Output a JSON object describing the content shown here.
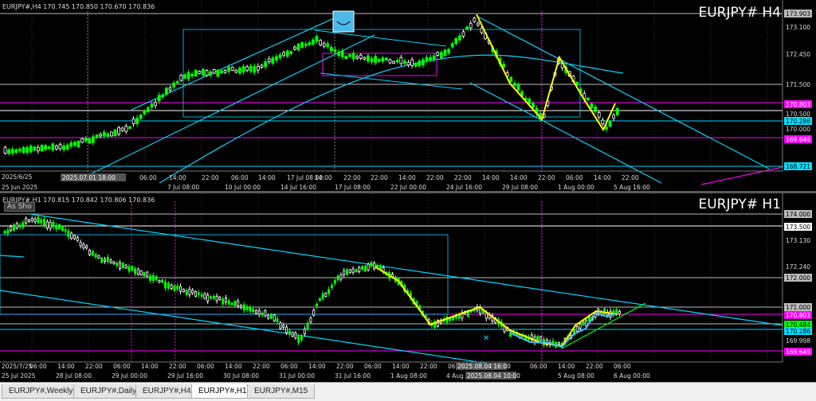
{
  "top_chart": {
    "header": "EURJPY#,H4  170.745 170.850 170.670 170.836",
    "symbol": "EURJPY#  H4",
    "price_labels": [
      "173.903",
      "173.100",
      "172.450",
      "171.500",
      "170.803",
      "170.500",
      "170.286",
      "170.000",
      "169.646",
      "168.721"
    ],
    "time_labels": [
      "2025/6/25",
      "25 Jun 2025",
      "2025.07.01 18:00",
      "06:00",
      "7 Jul 08:00",
      "14:00",
      "22:00",
      "10 Jul 00:00",
      "06:00",
      "14 Jul 16:00",
      "14:00",
      "17 Jul 08:00",
      "22:00",
      "22 Jul 00:00",
      "14:00",
      "24 Jul 16:00",
      "06:00",
      "29 Jul 08:00",
      "22:00",
      "1 Aug 00:00",
      "14:00",
      "5 Aug 16:00",
      "22:00",
      "06:00",
      "14:00",
      "22:00",
      "06:00",
      "14:00",
      "22:00",
      "06:00",
      "14:00",
      "22:00",
      "06:00"
    ],
    "time_date_label": "2025.07.01 18:00"
  },
  "bottom_chart": {
    "header": "EURJPY#,H1  170.815 170.842 170.806 170.836",
    "symbol": "EURJPY#  H1",
    "as_shot": "As Sho",
    "price_labels": [
      "174.000",
      "173.500",
      "173.130",
      "172.240",
      "172.000",
      "171.000",
      "170.803",
      "170.484",
      "170.286",
      "169.998",
      "169.649"
    ],
    "time_labels": [
      "2025/7/25",
      "06:00",
      "14:00",
      "22:00",
      "06:00",
      "14:00",
      "22:00",
      "06:00",
      "14:00",
      "22:00",
      "06:00",
      "14:00",
      "22:00",
      "06:00",
      "14:00",
      "22:00",
      "06:00",
      "14:00",
      "22:00",
      "06:00"
    ],
    "date_labels": [
      "25 Jul 2025",
      "28 Jul 08:00",
      "29 Jul 00:00",
      "29 Jul 16:00",
      "30 Jul 08:00",
      "31 Jul 00:00",
      "31 Jul 16:00",
      "1 Aug 08:00",
      "4 Aug",
      "6 Aug 00:00",
      "5 Aug 08:00"
    ],
    "highlight_label": "2025.08.04 10:00",
    "highlight_label2": "2025.08.04 16:00"
  },
  "tabs": [
    {
      "label": "EURJPY#,Weekly",
      "active": false
    },
    {
      "label": "EURJPY#,Daily",
      "active": false
    },
    {
      "label": "EURJPY#,H4",
      "active": false
    },
    {
      "label": "EURJPY#,H1",
      "active": true
    },
    {
      "label": "EURJPY#,M15",
      "active": false
    }
  ],
  "colors": {
    "bull": "#00ff00",
    "bear": "#ffffff",
    "cyan": "#00d8ff",
    "yellow": "#ffff00",
    "magenta": "#ff00ff",
    "aqua_label": "#00e0ff"
  }
}
